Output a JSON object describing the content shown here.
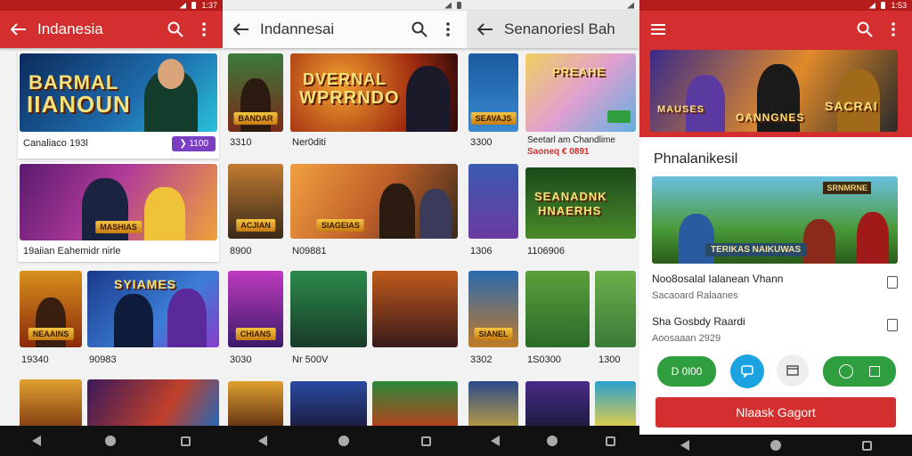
{
  "status": {
    "time": "1:53",
    "time_left": "1:37"
  },
  "panel1": {
    "title": "Indanesia",
    "hero_text": [
      "BARMAL",
      "IIANOUN"
    ],
    "hero_caption": "Canaliaco 193l",
    "hero_badge": "❯ 1100",
    "row2_caption": "19aiian Eahemidr nirle",
    "row2_plate": "MASHIAS",
    "small_caps": [
      "19340",
      "90983"
    ],
    "small_plates": [
      "NEAAINS",
      "SYIAMES"
    ]
  },
  "panel2": {
    "title": "Indannesai",
    "hero_text": [
      "DVERNAL",
      "WPRRNDO"
    ],
    "hero_caption": "Ner0diti",
    "left_caps": [
      "3310",
      "8900",
      "3030"
    ],
    "mid_caption": "N09881",
    "mid_plate": "SIAGEIAS",
    "bottom_caption": "Nr 500V",
    "left_plates": [
      "BANDAR",
      "ACJIAN",
      "CHIANS"
    ]
  },
  "panel3": {
    "title": "Senanoriesl Bah",
    "caps": [
      "3300",
      "1306",
      "3302"
    ],
    "feat_caption": "Seetarl am Chandlime",
    "feat_price": "Saoneq € 0891",
    "feat_text": "PREAHE",
    "mid_text": [
      "SEANADNK",
      "HNAERHS"
    ],
    "mid_caption": "1106906",
    "bottom_caps": [
      "1S0300",
      "1300"
    ],
    "plates": [
      "SEAVAJS",
      "SIANEL"
    ]
  },
  "panel4": {
    "hero_plates": [
      "MAUSES",
      "OANNGNES",
      "SACRAI"
    ],
    "section_title": "Phnalanikesil",
    "feat_plate_top": "SRNMRNE",
    "feat_plate_bottom": "TERIKAS NAIKUWAS",
    "items": [
      {
        "title": "Noo8osalal Ialanean Vhann",
        "sub": "Sacaoard Ralaanes"
      },
      {
        "title": "Sha Gosbdy Raardi",
        "sub": "Aoosaaan 2929"
      }
    ],
    "pill_left": "D 0l00",
    "cta": "Nlaask Gagort"
  },
  "colors": {
    "accent": "#d32f2f",
    "green": "#2e9e3e",
    "blue": "#1aa3e0",
    "purple": "#7b3fc4"
  },
  "icons": [
    "back-arrow-icon",
    "search-icon",
    "more-vert-icon",
    "menu-icon",
    "bookmark-icon",
    "chat-icon",
    "screen-icon",
    "globe-icon",
    "grid-icon"
  ]
}
